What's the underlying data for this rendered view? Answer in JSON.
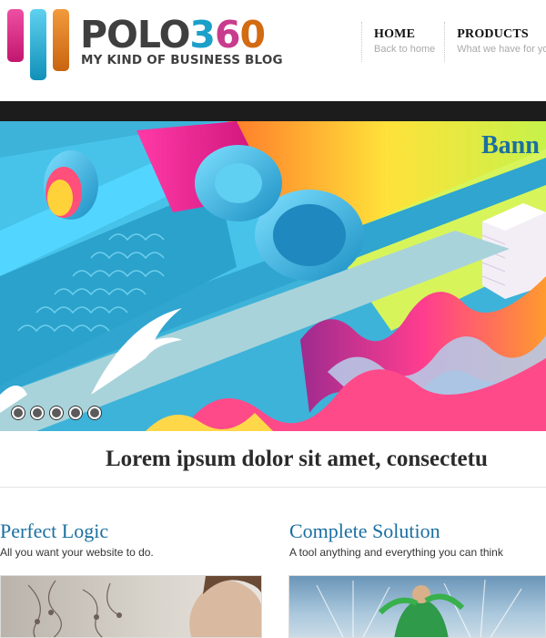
{
  "brand": {
    "name_part1": "POLO",
    "name_digit1": "3",
    "name_digit2": "6",
    "name_digit3": "0",
    "tagline": "MY KIND OF BUSINESS BLOG",
    "colors": {
      "pink": "#c83c8d",
      "blue": "#1aa0c9",
      "orange": "#d36b12",
      "gray": "#3f3f3f"
    }
  },
  "nav": {
    "items": [
      {
        "title": "HOME",
        "subtitle": "Back to home"
      },
      {
        "title": "PRODUCTS",
        "subtitle": "What we have for you"
      }
    ]
  },
  "banner": {
    "title": "Bann",
    "slide_count": 5
  },
  "main": {
    "tagline": "Lorem ipsum dolor sit amet, consectetu"
  },
  "features": [
    {
      "title": "Perfect Logic",
      "description": "All you want your website to do."
    },
    {
      "title": "Complete Solution",
      "description": "A tool anything and everything you can think"
    }
  ],
  "accent_color": "#1a6fa1"
}
